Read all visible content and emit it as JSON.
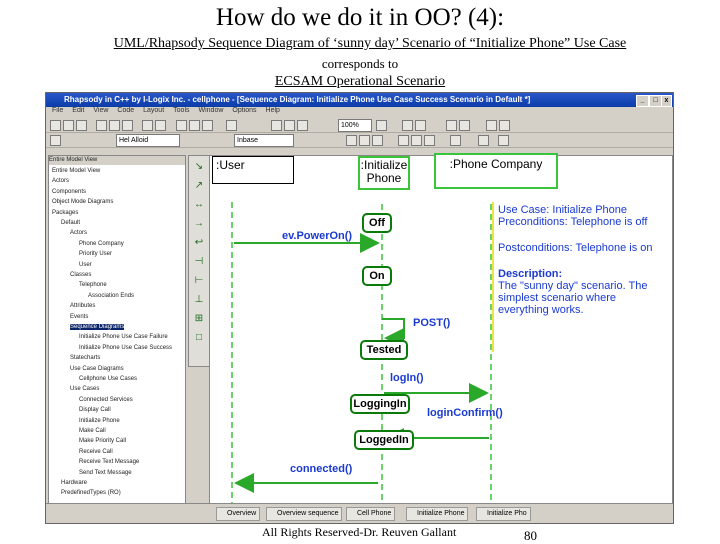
{
  "slide": {
    "title": "How do we do it in OO? (4):",
    "subtitle": "UML/Rhapsody Sequence Diagram of ‘sunny day’ Scenario of “Initialize Phone” Use Case",
    "corresponds": "corresponds to",
    "scenario": "ECSAM Operational Scenario",
    "footer_text": "All Rights Reserved-Dr. Reuven Gallant",
    "page_number": "80"
  },
  "window": {
    "title": "Rhapsody in C++ by I-Logix Inc. - cellphone - [Sequence Diagram: Initialize Phone Use Case Success Scenario in Default *]",
    "menu": [
      "File",
      "Edit",
      "View",
      "Code",
      "Layout",
      "Tools",
      "Window",
      "Options",
      "Help"
    ],
    "zoom": "100%",
    "combo_left": "Hel Alloid",
    "combo_right": "Inbase"
  },
  "browser": {
    "header": "Entire Model View",
    "rows": [
      {
        "text": "Entire Model View",
        "indent": 0
      },
      {
        "text": "Actors",
        "indent": 0
      },
      {
        "text": "Components",
        "indent": 0
      },
      {
        "text": "Object Mode Diagrams",
        "indent": 0
      },
      {
        "text": "Packages",
        "indent": 0
      },
      {
        "text": "Default",
        "indent": 1
      },
      {
        "text": "Actors",
        "indent": 2
      },
      {
        "text": "Phone Company",
        "indent": 3
      },
      {
        "text": "Priority User",
        "indent": 3
      },
      {
        "text": "User",
        "indent": 3
      },
      {
        "text": "Classes",
        "indent": 2
      },
      {
        "text": "Telephone",
        "indent": 3
      },
      {
        "text": "Association Ends",
        "indent": 4
      },
      {
        "text": "Attributes",
        "indent": 2
      },
      {
        "text": "Events",
        "indent": 2
      },
      {
        "text": "Sequence Diagrams",
        "indent": 2,
        "sel": true
      },
      {
        "text": "Initialize Phone Use Case Failure",
        "indent": 3
      },
      {
        "text": "Initialize Phone Use Case Success",
        "indent": 3
      },
      {
        "text": "Statecharts",
        "indent": 2
      },
      {
        "text": "Use Case Diagrams",
        "indent": 2
      },
      {
        "text": "Cellphone Use Cases",
        "indent": 3
      },
      {
        "text": "Use Cases",
        "indent": 2
      },
      {
        "text": "Connected Services",
        "indent": 3
      },
      {
        "text": "Display Call",
        "indent": 3
      },
      {
        "text": "Initialize Phone",
        "indent": 3
      },
      {
        "text": "Make Call",
        "indent": 3
      },
      {
        "text": "Make Priority Call",
        "indent": 3
      },
      {
        "text": "Receive Call",
        "indent": 3
      },
      {
        "text": "Receive Text Message",
        "indent": 3
      },
      {
        "text": "Send Text Message",
        "indent": 3
      },
      {
        "text": "Hardware",
        "indent": 1
      },
      {
        "text": "PredefinedTypes (RO)",
        "indent": 1
      }
    ]
  },
  "palette": [
    "↘",
    "↗",
    "↔",
    "→",
    "↩",
    "⊣",
    "⊢",
    "⊥",
    "⊞",
    "□"
  ],
  "diagram": {
    "lifelines": {
      "user": ":User",
      "phone_line1": ":Initialize",
      "phone_line2": "Phone",
      "company": ":Phone Company"
    },
    "states": {
      "off": "Off",
      "on": "On",
      "tested": "Tested",
      "logging_in": "LoggingIn",
      "logged_in": "LoggedIn"
    },
    "messages": {
      "power_on": "ev.PowerOn()",
      "post": "POST()",
      "login": "logIn()",
      "login_confirm": "loginConfirm()",
      "connected": "connected()"
    },
    "note": {
      "use_case": "Use Case: Initialize Phone",
      "preconditions": "Preconditions: Telephone is off",
      "postconditions": "Postconditions: Telephone is on",
      "description_label": "Description:",
      "description_text": "The \"sunny day\" scenario. The simplest scenario where everything works."
    },
    "colors": {
      "message_text": "#1a3ad0",
      "state_border": "#0a7a0a",
      "arrow": "#2aa82a",
      "lifeline": "#3ac43a",
      "note_border": "#e0e000"
    }
  },
  "statusbar": {
    "tabs": [
      "Overview",
      "Overview sequence",
      "Cell Phone",
      "Initialize Phone",
      "Initialize Pho"
    ]
  }
}
